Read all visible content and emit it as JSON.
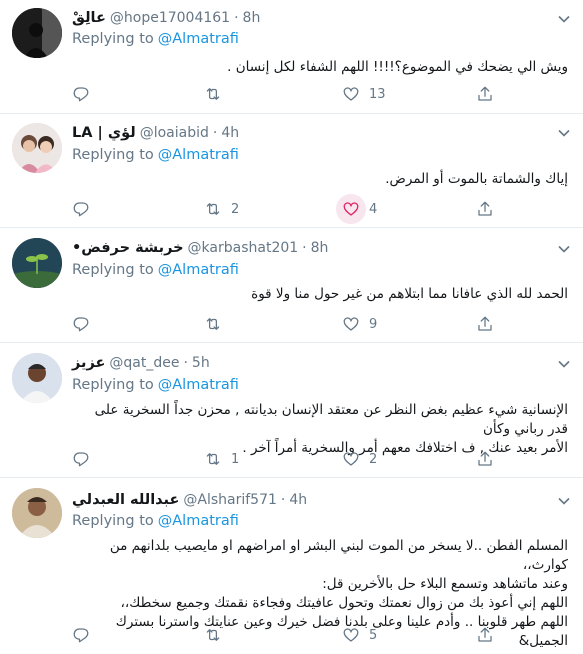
{
  "mention": "@Almatrafi",
  "replying_to_label": "Replying to",
  "tweets": [
    {
      "name": "عالِقْ",
      "handle": "@hope17004161",
      "separator": "·",
      "time": "8h",
      "text": "ويش الي يضحك في الموضوع؟!!!! اللهم الشفاء لكل إنسان .",
      "replies": "",
      "retweets": "",
      "likes": "13",
      "liked": false
    },
    {
      "name": "LA | لؤي",
      "handle": "@loaiabid",
      "separator": "·",
      "time": "4h",
      "text": "إياك والشماتة بالموت أو المرض.",
      "replies": "",
      "retweets": "2",
      "likes": "4",
      "liked": true
    },
    {
      "name": "•خربشة حرفض",
      "handle": "@karbashat201",
      "separator": "·",
      "time": "8h",
      "text": "الحمد لله الذي عافانا مما ابتلاهم من غير حول منا ولا قوة",
      "replies": "",
      "retweets": "",
      "likes": "9",
      "liked": false
    },
    {
      "name": "عزيز",
      "handle": "@qat_dee",
      "separator": "·",
      "time": "5h",
      "text_lines": [
        "الإنسانية شيء عظيم بغض النظر عن معتقد الإنسان بديانته , محزن جداً السخرية على قدر رباني وكأن",
        "الأمر بعيد عنك , ف اختلافك معهم أمر والسخرية أمراً آخر ."
      ],
      "replies": "",
      "retweets": "1",
      "likes": "2",
      "liked": false
    },
    {
      "name": "عبدالله العبدلي",
      "handle": "@Alsharif571",
      "separator": "·",
      "time": "4h",
      "text_lines": [
        "المسلم الفطن ..لا يسخر من الموت لبني البشر او امراضهم او مايصيب بلدانهم من كوارث،،",
        "وعند ماتشاهد وتسمع البلاء حل بالأخرين قل:",
        "اللهم إني أعوذ بك من زوال نعمتك وتحول عافيتك وفجاءة نقمتك وجميع سخطك،،",
        "اللهم طهر قلوبنا .. وأدم علينا وعلى بلدنا فضل خيرك وعين عنايتك واسترنا بسترك الجميل&"
      ],
      "replies": "",
      "retweets": "",
      "likes": "5",
      "liked": false
    }
  ],
  "icons": {
    "reply": "reply-icon",
    "retweet": "retweet-icon",
    "like": "heart-icon",
    "share": "share-icon",
    "caret": "chevron-down-icon"
  },
  "colors": {
    "link": "#1b95e0",
    "secondary": "#657786",
    "like_active": "#e0245e",
    "divider": "#e6ecf0"
  }
}
